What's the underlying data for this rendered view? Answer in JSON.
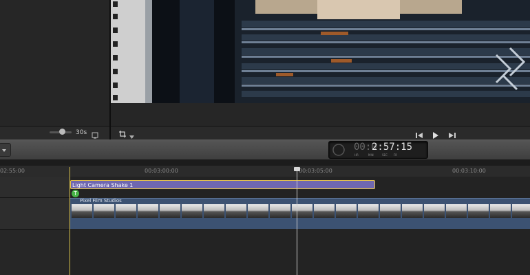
{
  "browser": {
    "zoom_value": "30s"
  },
  "timecode": {
    "dim_prefix": "00:0",
    "value": "2:57:15",
    "captions": [
      "HR",
      "MIN",
      "SEC",
      "FR"
    ]
  },
  "ruler": {
    "labels": [
      "02:55:00",
      "00:03:00:00",
      "00:03:05:00",
      "00:03:10:00"
    ]
  },
  "timeline": {
    "title_clip": "Light Camera Shake 1",
    "video_clip": "Pixel Film Studios"
  },
  "colors": {
    "title_clip": "#6f67b0",
    "title_border": "#e4c24a",
    "video_clip": "#3c5272",
    "connect": "#47b347"
  },
  "icons": [
    "filmstrip-icon",
    "crop-icon",
    "chevron-down-icon",
    "play-reverse-icon",
    "play-icon",
    "play-forward-icon",
    "menu-icon"
  ]
}
